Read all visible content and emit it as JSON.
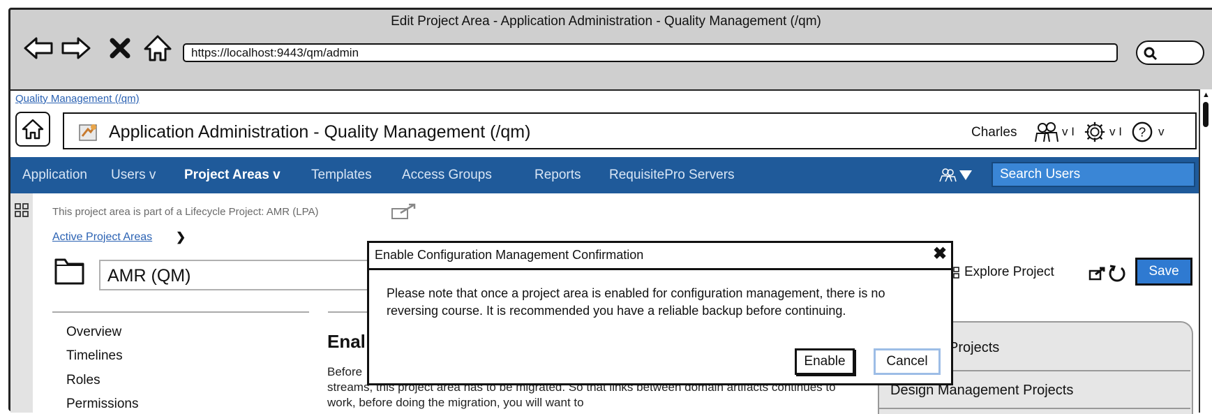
{
  "window": {
    "title": "Edit Project Area - Application Administration - Quality Management (/qm)",
    "url": "https://localhost:9443/qm/admin"
  },
  "breadcrumb": {
    "link": "Quality Management (/qm)"
  },
  "header": {
    "title": "Application Administration - Quality Management (/qm)",
    "user": "Charles",
    "caret": "v I",
    "caret_last": "v"
  },
  "nav": {
    "items": [
      {
        "label": "Application"
      },
      {
        "label": "Users v"
      },
      {
        "label": "Project Areas v"
      },
      {
        "label": "Templates"
      },
      {
        "label": "Access Groups"
      },
      {
        "label": "Reports"
      },
      {
        "label": "RequisitePro Servers"
      }
    ],
    "search_placeholder": "Search Users"
  },
  "project": {
    "lpa_note": "This project area is part of a Lifecycle Project: AMR (LPA)",
    "active_areas_link": "Active Project Areas",
    "chevron": "❯",
    "name": "AMR (QM)",
    "explore_label": "Explore Project",
    "save_label": "Save"
  },
  "sidebar": {
    "items": [
      {
        "label": "Overview"
      },
      {
        "label": "Timelines"
      },
      {
        "label": "Roles"
      },
      {
        "label": "Permissions"
      }
    ]
  },
  "section": {
    "heading": "Enal",
    "body": "Before\nstreams, this project area has to be migrated.  So that links between domain artifacts continues to work, before doing the migration, you will want to"
  },
  "right_panel": {
    "tabs": [
      {
        "label": "Projects"
      },
      {
        "label": "Design Management Projects"
      }
    ]
  },
  "dialog": {
    "title": "Enable Configuration Management Confirmation",
    "close_glyph": "✖",
    "message": "Please note that once a project area is enabled for configuration management, there is no reversing course.  It is recommended you have a reliable backup before continuing.",
    "enable_label": "Enable",
    "cancel_label": "Cancel"
  },
  "colors": {
    "nav_bar": "#1f5a9a",
    "link": "#2b62b3",
    "save_button": "#2f7ad1",
    "search_field": "#3a86d6"
  }
}
